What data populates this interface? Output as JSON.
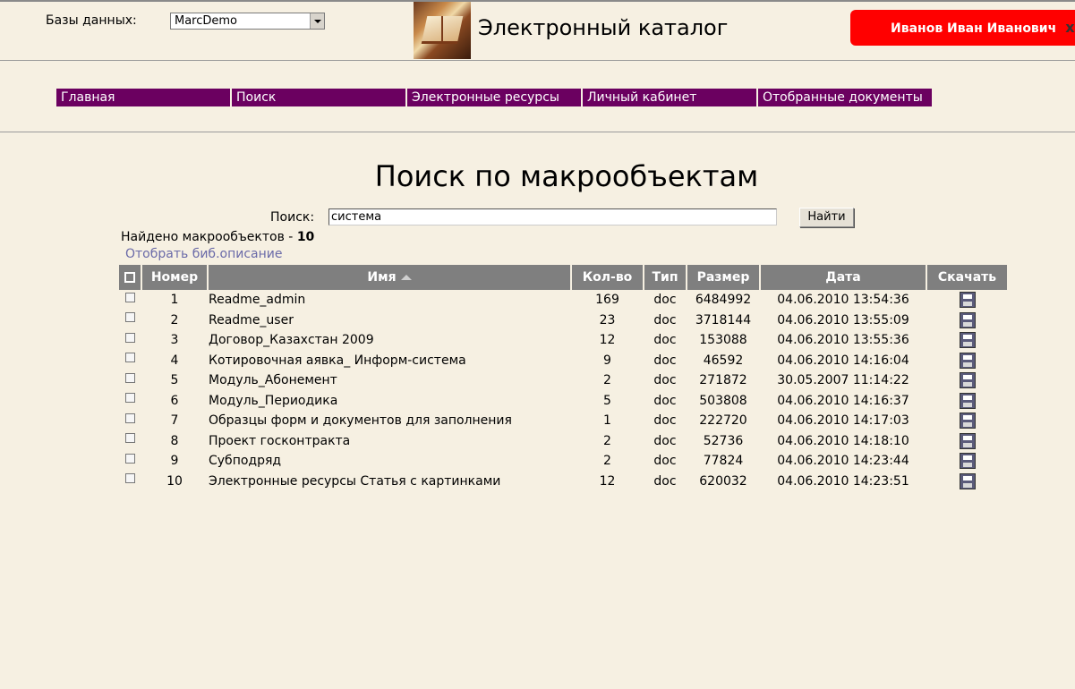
{
  "header": {
    "db_label": "Базы данных:",
    "db_value": "MarcDemo",
    "site_title": "Электронный каталог",
    "user_name": "Иванов Иван Иванович",
    "user_close": "x"
  },
  "nav": [
    "Главная",
    "Поиск",
    "Электронные ресурсы",
    "Личный кабинет",
    "Отобранные документы"
  ],
  "page": {
    "title": "Поиск по макрообъектам",
    "search_label": "Поиск:",
    "search_value": "система",
    "search_button": "Найти",
    "found_label": "Найдено макрообъектов - ",
    "found_count": "10",
    "select_link": "Отобрать биб.описание"
  },
  "table": {
    "columns": [
      "Номер",
      "Имя",
      "Кол-во",
      "Тип",
      "Размер",
      "Дата",
      "Скачать"
    ],
    "rows": [
      {
        "num": "1",
        "name": "Readme_admin",
        "count": "169",
        "type": "doc",
        "size": "6484992",
        "date": "04.06.2010 13:54:36"
      },
      {
        "num": "2",
        "name": "Readme_user",
        "count": "23",
        "type": "doc",
        "size": "3718144",
        "date": "04.06.2010 13:55:09"
      },
      {
        "num": "3",
        "name": "Договор_Казахстан 2009",
        "count": "12",
        "type": "doc",
        "size": "153088",
        "date": "04.06.2010 13:55:36"
      },
      {
        "num": "4",
        "name": "Котировочная аявка_ Информ-система",
        "count": "9",
        "type": "doc",
        "size": "46592",
        "date": "04.06.2010 14:16:04"
      },
      {
        "num": "5",
        "name": "Модуль_Абонемент",
        "count": "2",
        "type": "doc",
        "size": "271872",
        "date": "30.05.2007 11:14:22"
      },
      {
        "num": "6",
        "name": "Модуль_Периодика",
        "count": "5",
        "type": "doc",
        "size": "503808",
        "date": "04.06.2010 14:16:37"
      },
      {
        "num": "7",
        "name": "Образцы форм и документов для заполнения",
        "count": "1",
        "type": "doc",
        "size": "222720",
        "date": "04.06.2010 14:17:03"
      },
      {
        "num": "8",
        "name": "Проект госконтракта",
        "count": "2",
        "type": "doc",
        "size": "52736",
        "date": "04.06.2010 14:18:10"
      },
      {
        "num": "9",
        "name": "Субподряд",
        "count": "2",
        "type": "doc",
        "size": "77824",
        "date": "04.06.2010 14:23:44"
      },
      {
        "num": "10",
        "name": "Электронные ресурсы Статья с картинками",
        "count": "12",
        "type": "doc",
        "size": "620032",
        "date": "04.06.2010 14:23:51"
      }
    ]
  }
}
